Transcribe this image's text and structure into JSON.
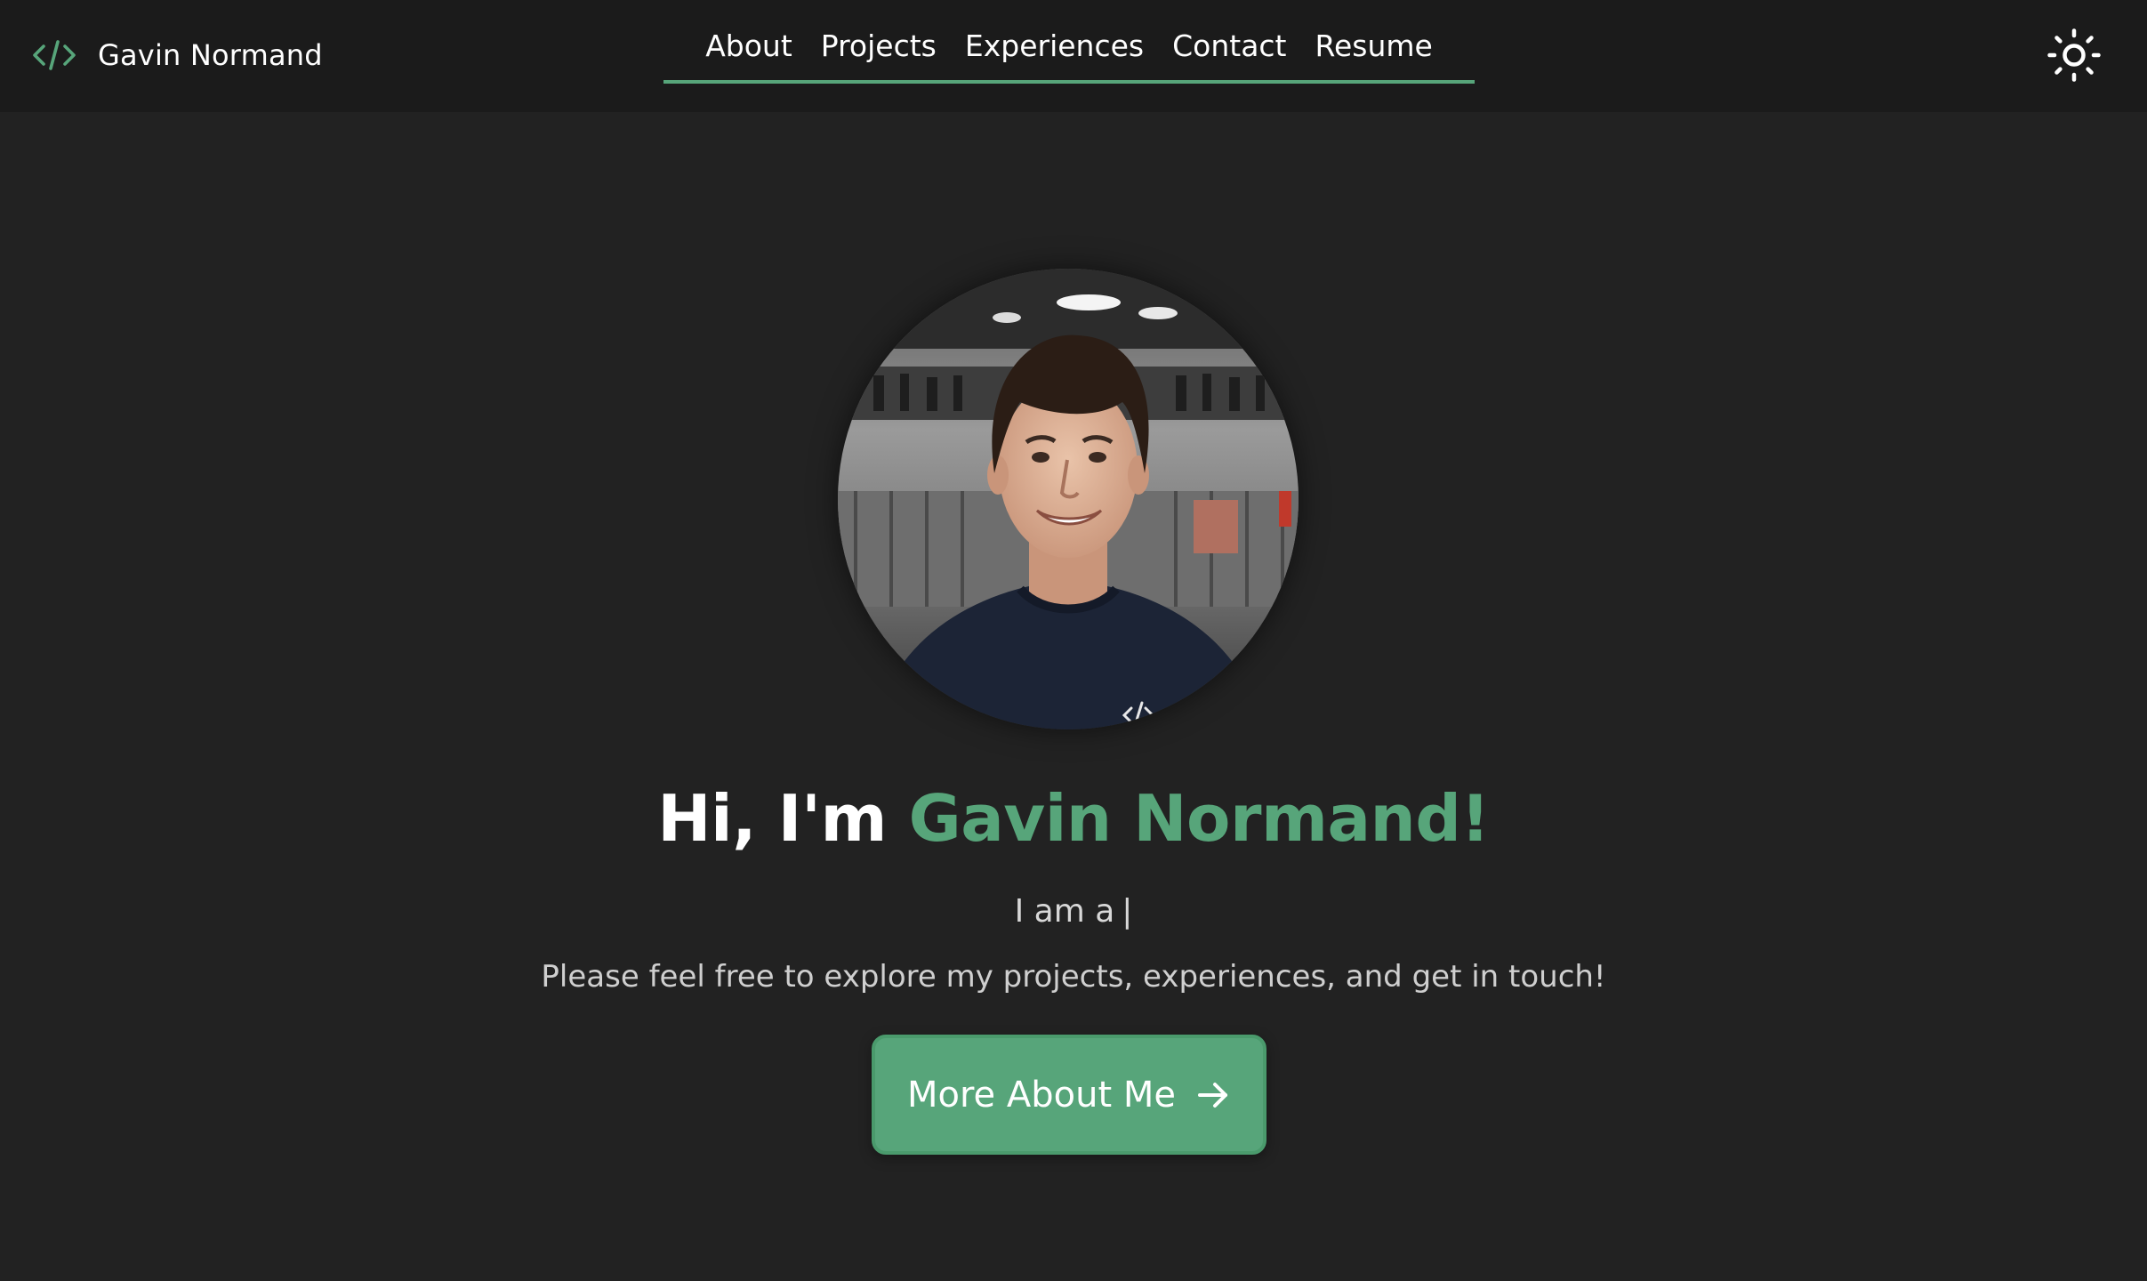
{
  "brand": {
    "name": "Gavin Normand",
    "icon": "code-icon"
  },
  "nav": {
    "links": [
      {
        "label": "About"
      },
      {
        "label": "Projects"
      },
      {
        "label": "Experiences"
      },
      {
        "label": "Contact"
      },
      {
        "label": "Resume"
      }
    ],
    "theme_toggle_icon": "sun-icon"
  },
  "hero": {
    "avatar_icon": "profile-photo",
    "greeting": "Hi, I'm",
    "name": "Gavin Normand!",
    "typing_prefix": "I am a",
    "typing_cursor": "|",
    "tagline": "Please feel free to explore my projects, experiences, and get in touch!",
    "cta_label": "More About Me",
    "cta_icon": "arrow-right-icon"
  },
  "colors": {
    "background": "#222222",
    "navbar": "#1b1b1b",
    "accent": "#57a57a",
    "text": "#ffffff"
  }
}
